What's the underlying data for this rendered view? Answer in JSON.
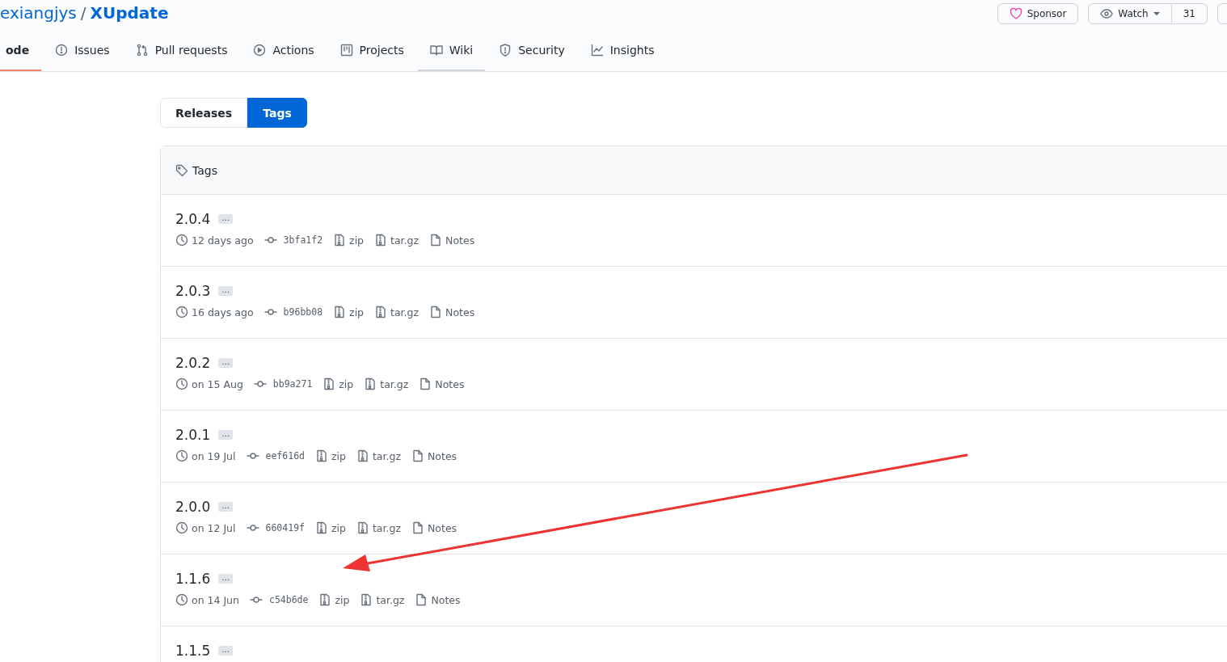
{
  "repo": {
    "owner": "exiangjys",
    "separator": "/",
    "name": "XUpdate"
  },
  "header_buttons": [
    {
      "kind": "sponsor",
      "label": "Sponsor"
    },
    {
      "kind": "watch",
      "label": "Watch",
      "count": "31"
    }
  ],
  "tabs": [
    {
      "label": "ode",
      "selected": true,
      "hovered": false
    },
    {
      "label": "Issues",
      "selected": false,
      "hovered": false
    },
    {
      "label": "Pull requests",
      "selected": false,
      "hovered": false
    },
    {
      "label": "Actions",
      "selected": false,
      "hovered": false
    },
    {
      "label": "Projects",
      "selected": false,
      "hovered": false
    },
    {
      "label": "Wiki",
      "selected": false,
      "hovered": true
    },
    {
      "label": "Security",
      "selected": false,
      "hovered": false
    },
    {
      "label": "Insights",
      "selected": false,
      "hovered": false
    }
  ],
  "switcher": [
    {
      "label": "Releases",
      "selected": false
    },
    {
      "label": "Tags",
      "selected": true
    }
  ],
  "tags_box": {
    "title": "Tags",
    "tags": [
      {
        "name": "2.0.4",
        "more": "…",
        "date": "12 days ago",
        "commit": "3bfa1f2",
        "zip": "zip",
        "targz": "tar.gz",
        "notes": "Notes"
      },
      {
        "name": "2.0.3",
        "more": "…",
        "date": "16 days ago",
        "commit": "b96bb08",
        "zip": "zip",
        "targz": "tar.gz",
        "notes": "Notes"
      },
      {
        "name": "2.0.2",
        "more": "…",
        "date": "on 15 Aug",
        "commit": "bb9a271",
        "zip": "zip",
        "targz": "tar.gz",
        "notes": "Notes"
      },
      {
        "name": "2.0.1",
        "more": "…",
        "date": "on 19 Jul",
        "commit": "eef616d",
        "zip": "zip",
        "targz": "tar.gz",
        "notes": "Notes"
      },
      {
        "name": "2.0.0",
        "more": "…",
        "date": "on 12 Jul",
        "commit": "660419f",
        "zip": "zip",
        "targz": "tar.gz",
        "notes": "Notes"
      },
      {
        "name": "1.1.6",
        "more": "…",
        "date": "on 14 Jun",
        "commit": "c54b6de",
        "zip": "zip",
        "targz": "tar.gz",
        "notes": "Notes"
      },
      {
        "name": "1.1.5",
        "more": "…"
      }
    ]
  }
}
